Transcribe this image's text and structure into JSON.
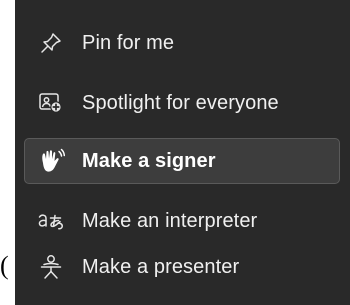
{
  "background_fragment": "(",
  "menu": {
    "items": [
      {
        "label": "Pin for me",
        "icon": "pin-icon",
        "selected": false
      },
      {
        "label": "Spotlight for everyone",
        "icon": "spotlight-icon",
        "selected": false
      },
      {
        "label": "Make a signer",
        "icon": "hand-wave-icon",
        "selected": true
      },
      {
        "label": "Make an interpreter",
        "icon": "translate-icon",
        "selected": false
      },
      {
        "label": "Make a presenter",
        "icon": "presenter-icon",
        "selected": false
      }
    ]
  },
  "colors": {
    "menu_background": "#292929",
    "selected_background": "#3d3d3d",
    "selected_border": "#5a5a5a",
    "text": "#f0f0f0"
  }
}
